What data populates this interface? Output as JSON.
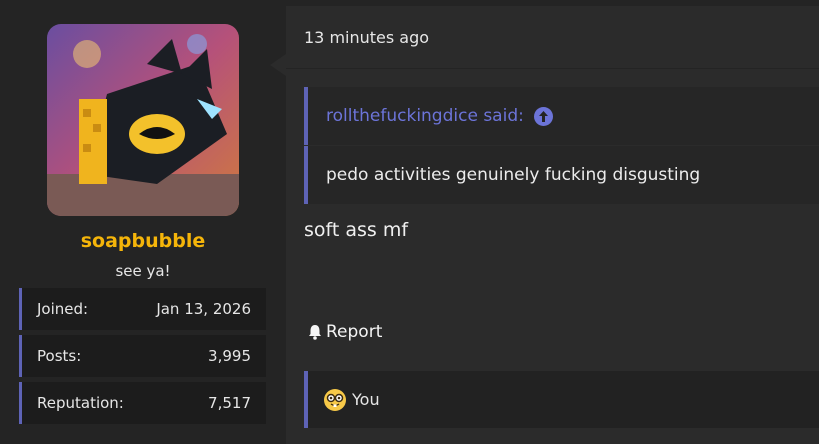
{
  "user": {
    "name": "soapbubble",
    "title": "see ya!",
    "stats": [
      {
        "label": "Joined:",
        "value": "Jan 13, 2026"
      },
      {
        "label": "Posts:",
        "value": "3,995"
      },
      {
        "label": "Reputation:",
        "value": "7,517"
      }
    ]
  },
  "post": {
    "time": "13 minutes ago",
    "quote_author": "rollthefuckingdice said:",
    "quote_text": "pedo activities genuinely fucking disgusting",
    "message": "soft ass mf",
    "report_label": "Report",
    "reaction_label": "You"
  },
  "colors": {
    "username": "#f5b50a",
    "accent": "#5e63b6",
    "quote_link": "#6c74d8"
  },
  "icons": [
    "bell-icon",
    "arrow-up-circle-icon",
    "nerd-face-emoji"
  ]
}
